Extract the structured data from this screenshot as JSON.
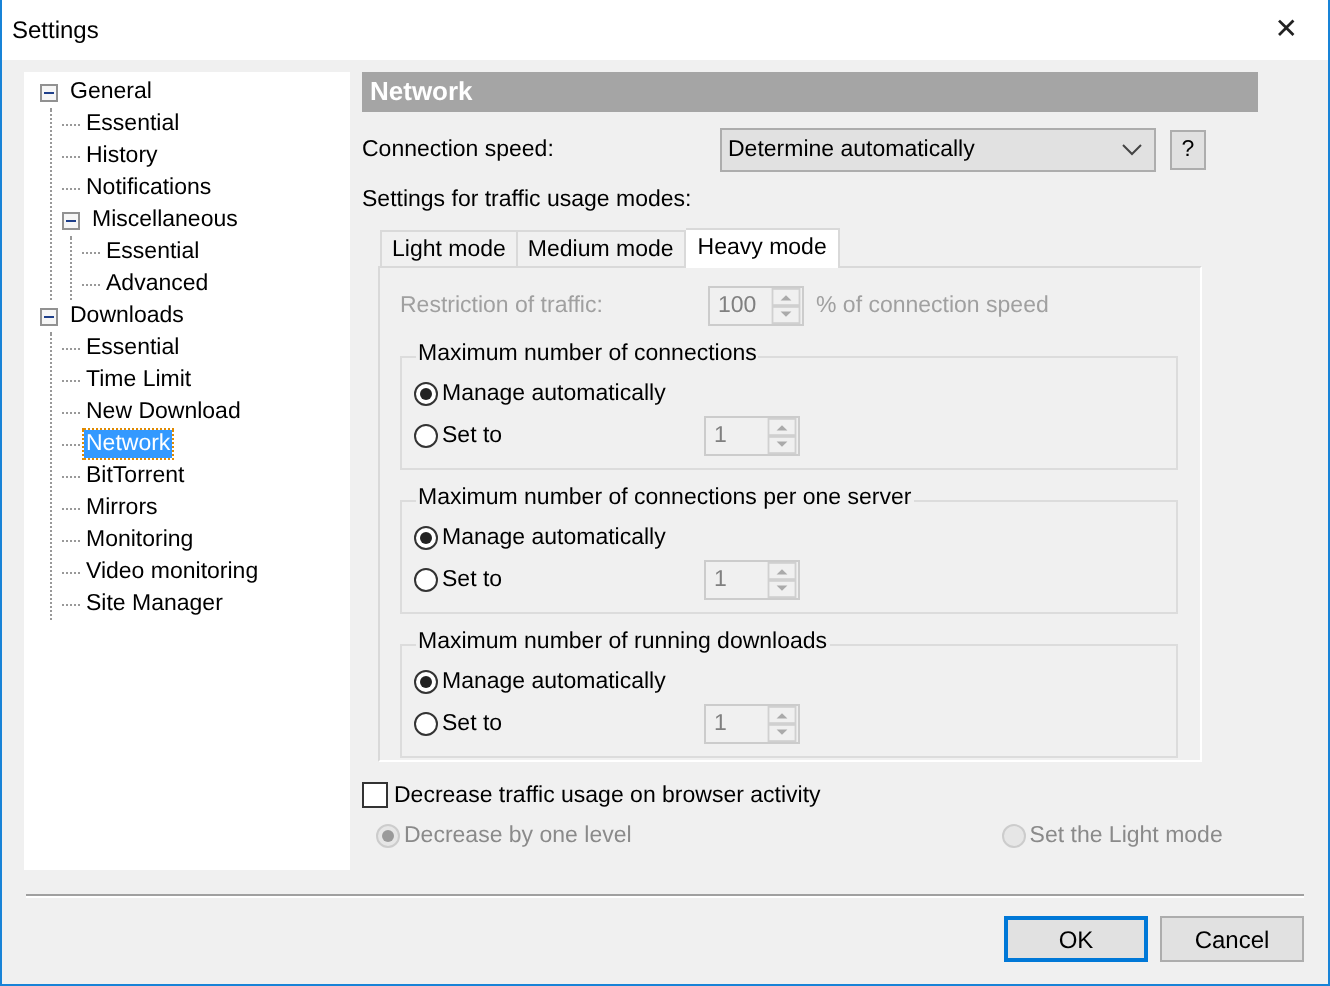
{
  "window": {
    "title": "Settings",
    "close": "✕"
  },
  "sidebar": {
    "tree": [
      {
        "label": "General",
        "expanded": true,
        "selected": false,
        "children": [
          {
            "label": "Essential",
            "selected": false
          },
          {
            "label": "History",
            "selected": false
          },
          {
            "label": "Notifications",
            "selected": false
          },
          {
            "label": "Miscellaneous",
            "expanded": true,
            "selected": false,
            "children": [
              {
                "label": "Essential",
                "selected": false
              },
              {
                "label": "Advanced",
                "selected": false
              }
            ]
          }
        ]
      },
      {
        "label": "Downloads",
        "expanded": true,
        "selected": false,
        "children": [
          {
            "label": "Essential",
            "selected": false
          },
          {
            "label": "Time Limit",
            "selected": false
          },
          {
            "label": "New Download",
            "selected": false
          },
          {
            "label": "Network",
            "selected": true
          },
          {
            "label": "BitTorrent",
            "selected": false
          },
          {
            "label": "Mirrors",
            "selected": false
          },
          {
            "label": "Monitoring",
            "selected": false
          },
          {
            "label": "Video monitoring",
            "selected": false
          },
          {
            "label": "Site Manager",
            "selected": false
          }
        ]
      }
    ]
  },
  "section_title": "Network",
  "connection_speed": {
    "label": "Connection speed:",
    "value": "Determine automatically",
    "help": "?"
  },
  "modes_label": "Settings for traffic usage modes:",
  "tabs": [
    {
      "label": "Light mode",
      "selected": false
    },
    {
      "label": "Medium mode",
      "selected": false
    },
    {
      "label": "Heavy mode",
      "selected": true
    }
  ],
  "restriction": {
    "label": "Restriction of traffic:",
    "value": "100",
    "unit": "% of connection speed",
    "disabled": true
  },
  "groups": [
    {
      "title": "Maximum number of connections",
      "options": [
        {
          "label": "Manage automatically",
          "selected": true
        },
        {
          "label": "Set to",
          "selected": false
        }
      ],
      "spin_value": "1"
    },
    {
      "title": "Maximum number of connections per one server",
      "options": [
        {
          "label": "Manage automatically",
          "selected": true
        },
        {
          "label": "Set to",
          "selected": false
        }
      ],
      "spin_value": "1"
    },
    {
      "title": "Maximum number of running downloads",
      "options": [
        {
          "label": "Manage automatically",
          "selected": true
        },
        {
          "label": "Set to",
          "selected": false
        }
      ],
      "spin_value": "1"
    }
  ],
  "browser_checkbox": {
    "label": "Decrease traffic usage on browser activity",
    "checked": false
  },
  "browser_options": [
    {
      "label": "Decrease by one level",
      "selected": true,
      "disabled": true
    },
    {
      "label": "Set the Light mode",
      "selected": false,
      "disabled": true
    }
  ],
  "buttons": [
    {
      "label": "OK",
      "default": true
    },
    {
      "label": "Cancel",
      "default": false
    }
  ]
}
